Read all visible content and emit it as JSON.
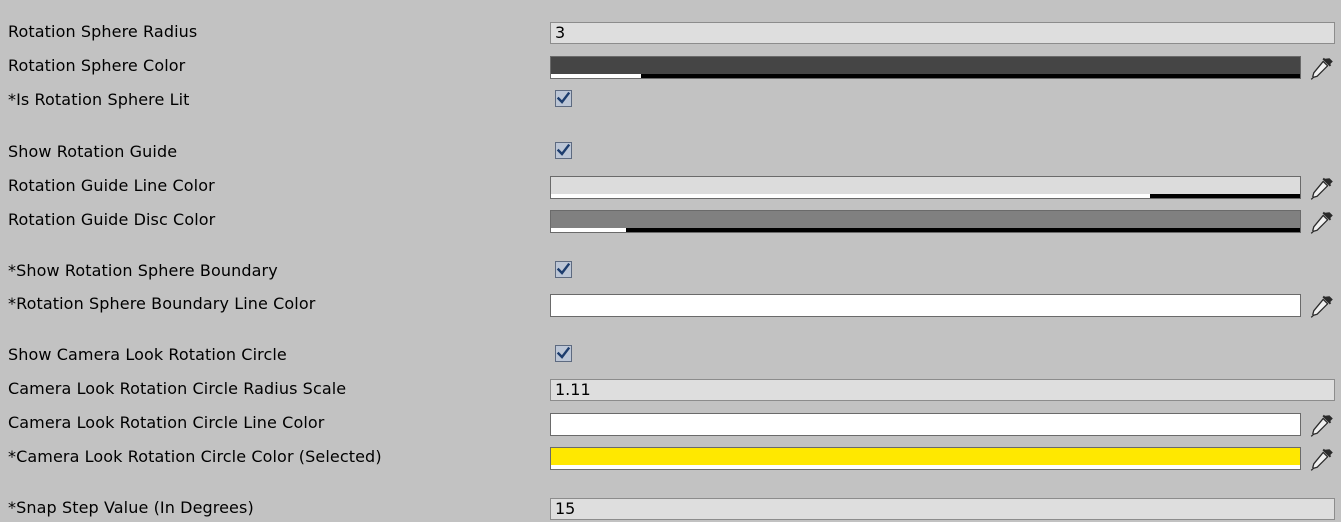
{
  "inspector": {
    "rows": [
      {
        "label": "Rotation Sphere Radius",
        "type": "number",
        "value": "3"
      },
      {
        "label": "Rotation Sphere Color",
        "type": "color",
        "color": "#454545",
        "alpha": 0.12
      },
      {
        "label": "*Is Rotation Sphere Lit",
        "type": "checkbox",
        "checked": true
      },
      {
        "label": "Show Rotation Guide",
        "type": "checkbox",
        "checked": true
      },
      {
        "label": "Rotation Guide Line Color",
        "type": "color",
        "color": "#dcdcdc",
        "alpha": 0.8
      },
      {
        "label": "Rotation Guide Disc Color",
        "type": "color",
        "color": "#808080",
        "alpha": 0.1
      },
      {
        "label": "*Show Rotation Sphere Boundary",
        "type": "checkbox",
        "checked": true
      },
      {
        "label": "*Rotation Sphere Boundary Line Color",
        "type": "color",
        "color": "#ffffff",
        "alpha": 1.0
      },
      {
        "label": "Show Camera Look Rotation Circle",
        "type": "checkbox",
        "checked": true
      },
      {
        "label": "Camera Look Rotation Circle Radius Scale",
        "type": "number",
        "value": "1.11"
      },
      {
        "label": "Camera Look Rotation Circle Line Color",
        "type": "color",
        "color": "#ffffff",
        "alpha": 1.0
      },
      {
        "label": "*Camera Look Rotation Circle Color (Selected)",
        "type": "color",
        "color": "#ffe800",
        "alpha": 1.0
      },
      {
        "label": "*Snap Step Value (In Degrees)",
        "type": "number",
        "value": "15"
      }
    ]
  },
  "icons": {
    "checkbox": "checkmark-icon",
    "picker": "eyedropper-icon"
  },
  "colors": {
    "background": "#c2c2c2",
    "field": "#dedede",
    "checkbox_fill": "#bcc6d6",
    "checkmark": "#1d3d6e"
  }
}
